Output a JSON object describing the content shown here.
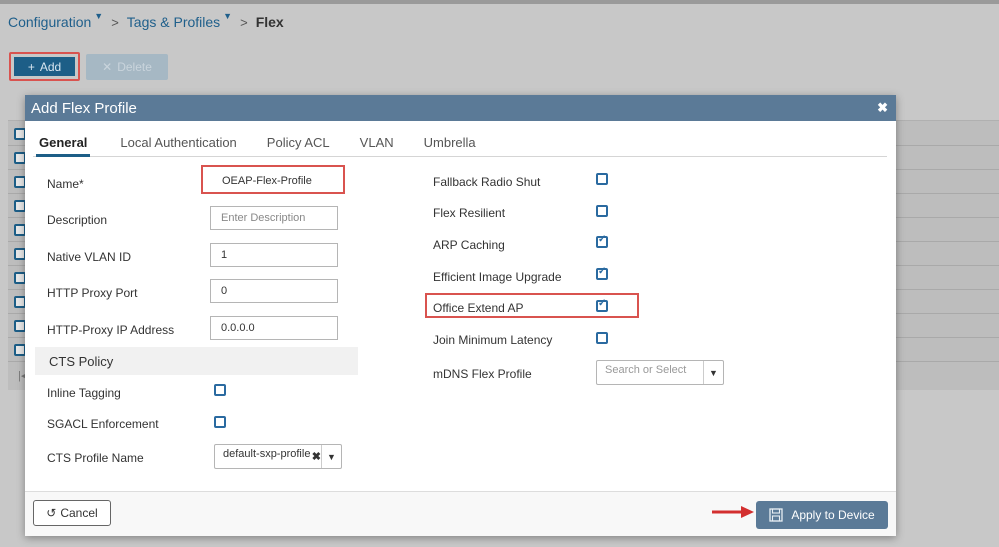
{
  "breadcrumb": {
    "configuration": "Configuration",
    "tags_profiles": "Tags & Profiles",
    "current": "Flex"
  },
  "toolbar": {
    "add_label": "Add",
    "delete_label": "Delete"
  },
  "modal": {
    "title": "Add Flex Profile",
    "tabs": [
      {
        "label": "General",
        "active": true
      },
      {
        "label": "Local Authentication",
        "active": false
      },
      {
        "label": "Policy ACL",
        "active": false
      },
      {
        "label": "VLAN",
        "active": false
      },
      {
        "label": "Umbrella",
        "active": false
      }
    ],
    "left": {
      "name_label": "Name*",
      "name_value": "OEAP-Flex-Profile",
      "description_label": "Description",
      "description_placeholder": "Enter Description",
      "native_vlan_label": "Native VLAN ID",
      "native_vlan_value": "1",
      "http_proxy_port_label": "HTTP Proxy Port",
      "http_proxy_port_value": "0",
      "http_proxy_ip_label": "HTTP-Proxy IP Address",
      "http_proxy_ip_value": "0.0.0.0",
      "cts_header": "CTS Policy",
      "inline_tagging_label": "Inline Tagging",
      "inline_tagging_checked": false,
      "sgacl_label": "SGACL Enforcement",
      "sgacl_checked": false,
      "cts_profile_label": "CTS Profile Name",
      "cts_profile_value": "default-sxp-profile"
    },
    "right": {
      "fallback_radio_label": "Fallback Radio Shut",
      "fallback_radio_checked": false,
      "flex_resilient_label": "Flex Resilient",
      "flex_resilient_checked": false,
      "arp_caching_label": "ARP Caching",
      "arp_caching_checked": true,
      "efficient_image_label": "Efficient Image Upgrade",
      "efficient_image_checked": true,
      "office_extend_label": "Office Extend AP",
      "office_extend_checked": true,
      "join_min_latency_label": "Join Minimum Latency",
      "join_min_latency_checked": false,
      "mdns_label": "mDNS Flex Profile",
      "mdns_placeholder": "Search or Select"
    },
    "footer": {
      "cancel_label": "Cancel",
      "apply_label": "Apply to Device"
    }
  },
  "colors": {
    "brand": "#1d5e87",
    "header": "#5b7a97",
    "highlight": "#d9534f"
  }
}
